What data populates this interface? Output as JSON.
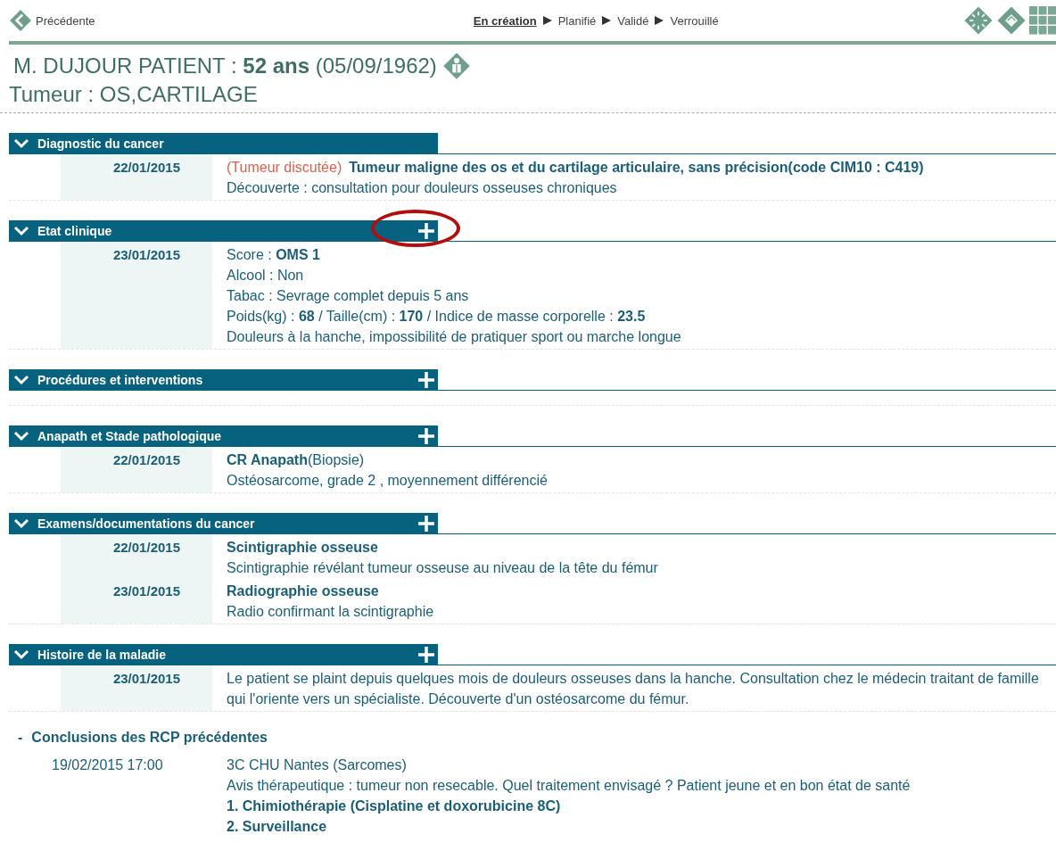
{
  "nav": {
    "back": "Précédente",
    "steps": [
      {
        "label": "En création",
        "selected": true
      },
      {
        "label": "Planifié",
        "selected": false
      },
      {
        "label": "Validé",
        "selected": false
      },
      {
        "label": "Verrouillé",
        "selected": false
      }
    ]
  },
  "patient": {
    "name": "M. DUJOUR PATIENT :",
    "age": "52 ans",
    "birth": "(05/09/1962)"
  },
  "tumor": "Tumeur : OS,CARTILAGE",
  "sections": [
    {
      "title": "Diagnostic du cancer",
      "can_add": false,
      "annotated": false,
      "entries": [
        {
          "date": "22/01/2015",
          "status": "(Tumeur discutée)",
          "lines": [
            "**Tumeur maligne des os et du cartilage articulaire, sans précision(code CIM10 : C419)**",
            "Découverte : consultation pour douleurs osseuses chroniques"
          ]
        }
      ]
    },
    {
      "title": "Etat clinique",
      "can_add": true,
      "annotated": true,
      "entries": [
        {
          "date": "23/01/2015",
          "lines": [
            "Score : **OMS 1**",
            "Alcool : Non",
            "Tabac : Sevrage complet depuis 5 ans",
            "Poids(kg) : **68** / Taille(cm) : **170** / Indice de masse corporelle : **23.5**",
            "Douleurs à la hanche, impossibilité de pratiquer sport ou marche longue"
          ]
        }
      ]
    },
    {
      "title": "Procédures et interventions",
      "can_add": true,
      "annotated": false
    },
    {
      "title": "Anapath et Stade pathologique",
      "can_add": true,
      "annotated": false,
      "entries": [
        {
          "date": "22/01/2015",
          "lines": [
            "**CR Anapath**(Biopsie)",
            "Ostéosarcome, grade 2 , moyennement différencié"
          ]
        }
      ]
    },
    {
      "title": "Examens/documentations du cancer",
      "can_add": true,
      "annotated": false,
      "entries": [
        {
          "date": "22/01/2015",
          "lines": [
            "**Scintigraphie osseuse**",
            "Scintigraphie révélant tumeur osseuse au niveau de la tête du fémur"
          ]
        },
        {
          "date": "23/01/2015",
          "lines": [
            "**Radiographie osseuse**",
            "Radio confirmant la scintigraphie"
          ]
        }
      ]
    },
    {
      "title": "Histoire de la maladie",
      "can_add": true,
      "annotated": false,
      "entries": [
        {
          "date": "23/01/2015",
          "lines": [
            "Le patient se plaint depuis quelques mois de douleurs osseuses dans la hanche. Consultation chez le médecin traitant de famille qui l'oriente vers un spécialiste. Découverte d'un ostéosarcome du fémur."
          ]
        }
      ]
    }
  ],
  "conclusions": {
    "marker": "-",
    "title": "Conclusions des RCP précédentes",
    "items": [
      {
        "datetime": "19/02/2015 17:00",
        "lines": [
          "3C CHU Nantes (Sarcomes)",
          "Avis thérapeutique : tumeur non resecable. Quel traitement envisagé ? Patient jeune et en bon état de santé",
          "**1. Chimiothérapie (Cisplatine et doxorubicine 8C)**",
          "**2. Surveillance**"
        ]
      }
    ]
  }
}
